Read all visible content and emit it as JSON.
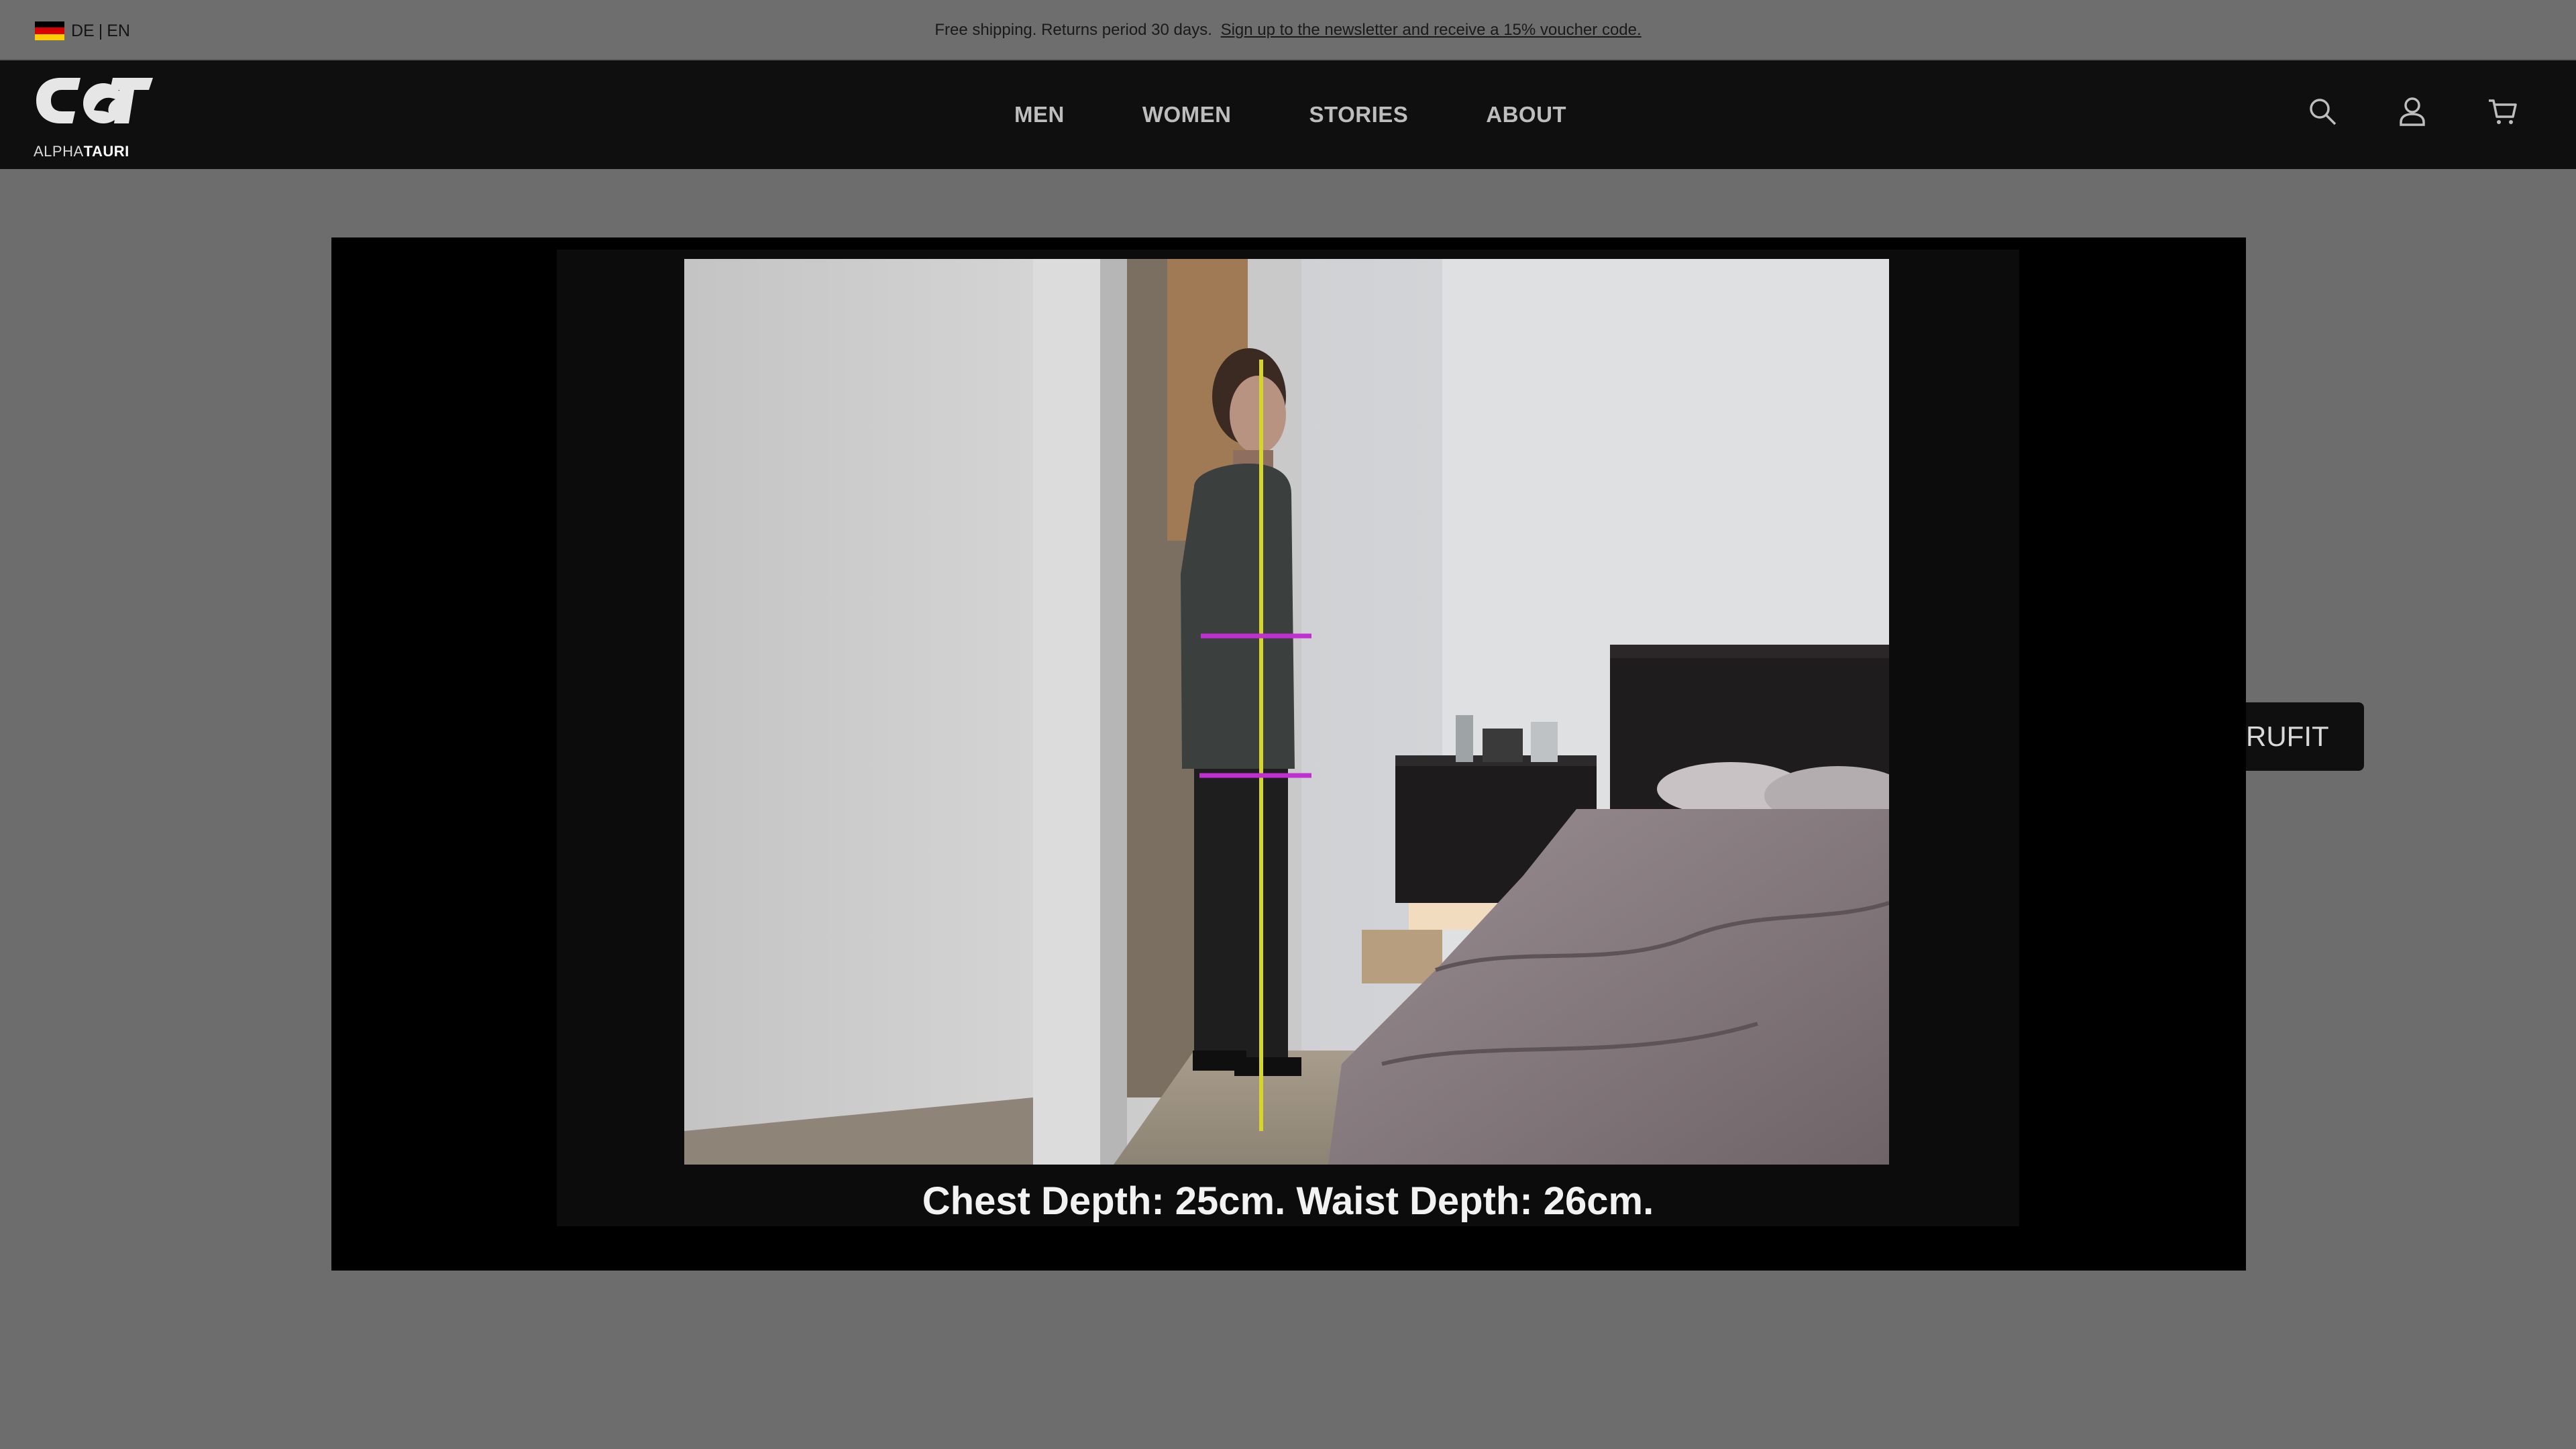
{
  "topbar": {
    "lang_de": "DE",
    "lang_sep": "|",
    "lang_en": "EN",
    "flag_colors": [
      "#000000",
      "#dd0000",
      "#ffce00"
    ],
    "announcement": "Free shipping. Returns period 30 days.",
    "newsletter_link": "Sign up to the newsletter and receive a 15% voucher code."
  },
  "header": {
    "logo_word_light": "ALPHA",
    "logo_word_bold": "TAURI",
    "nav": [
      {
        "label": "MEN"
      },
      {
        "label": "WOMEN"
      },
      {
        "label": "STORIES"
      },
      {
        "label": "ABOUT"
      }
    ],
    "icons": [
      "search-icon",
      "account-icon",
      "cart-icon"
    ]
  },
  "video": {
    "caption": "Chest Depth: 25cm. Waist Depth: 26cm.",
    "axis_line_color": "#d6d62a",
    "measure_line_color": "#c02fd0"
  },
  "fit_button": {
    "label": "RUFIT"
  }
}
